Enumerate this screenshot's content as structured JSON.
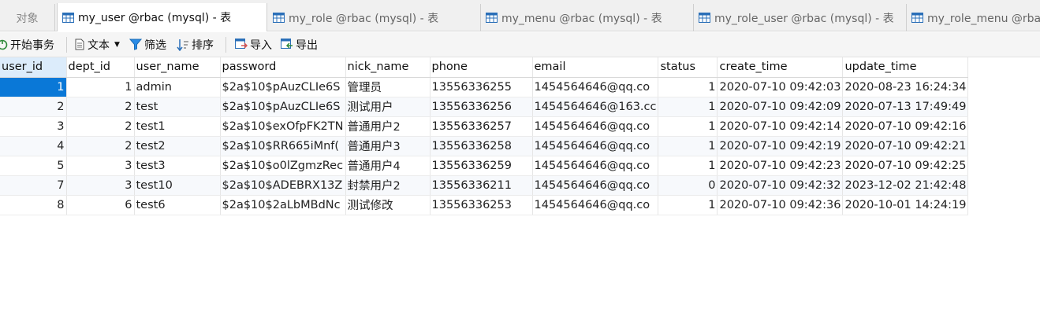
{
  "tabs": {
    "objects_label": "对象",
    "items": [
      {
        "label": "my_user @rbac (mysql) - 表",
        "active": true
      },
      {
        "label": "my_role @rbac (mysql) - 表",
        "active": false
      },
      {
        "label": "my_menu @rbac (mysql) - 表",
        "active": false
      },
      {
        "label": "my_role_user @rbac (mysql) - 表",
        "active": false
      },
      {
        "label": "my_role_menu @rbac (mysql) - 表",
        "active": false
      }
    ]
  },
  "toolbar": {
    "begin_transaction": "开始事务",
    "text": "文本",
    "filter": "筛选",
    "sort": "排序",
    "import": "导入",
    "export": "导出"
  },
  "grid": {
    "columns": [
      "user_id",
      "dept_id",
      "user_name",
      "password",
      "nick_name",
      "phone",
      "email",
      "status",
      "create_time",
      "update_time"
    ],
    "rows": [
      [
        "1",
        "1",
        "admin",
        "$2a$10$pAuzCLIe6S",
        "管理员",
        "13556336255",
        "1454564646@qq.co",
        "1",
        "2020-07-10 09:42:03",
        "2020-08-23 16:24:34"
      ],
      [
        "2",
        "2",
        "test",
        "$2a$10$pAuzCLIe6S",
        "测试用户",
        "13556336256",
        "1454564646@163.cc",
        "1",
        "2020-07-10 09:42:09",
        "2020-07-13 17:49:49"
      ],
      [
        "3",
        "2",
        "test1",
        "$2a$10$exOfpFK2TN",
        "普通用户2",
        "13556336257",
        "1454564646@qq.co",
        "1",
        "2020-07-10 09:42:14",
        "2020-07-10 09:42:16"
      ],
      [
        "4",
        "2",
        "test2",
        "$2a$10$RR665iMnf(",
        "普通用户3",
        "13556336258",
        "1454564646@qq.co",
        "1",
        "2020-07-10 09:42:19",
        "2020-07-10 09:42:21"
      ],
      [
        "5",
        "3",
        "test3",
        "$2a$10$o0lZgmzRec",
        "普通用户4",
        "13556336259",
        "1454564646@qq.co",
        "1",
        "2020-07-10 09:42:23",
        "2020-07-10 09:42:25"
      ],
      [
        "7",
        "3",
        "test10",
        "$2a$10$ADEBRX13Z",
        "封禁用户2",
        "13556336211",
        "1454564646@qq.co",
        "0",
        "2020-07-10 09:42:32",
        "2023-12-02 21:42:48"
      ],
      [
        "8",
        "6",
        "test6",
        "$2a$10$2aLbMBdNc",
        "测试修改",
        "13556336253",
        "1454564646@qq.co",
        "1",
        "2020-07-10 09:42:36",
        "2020-10-01 14:24:19"
      ]
    ]
  }
}
